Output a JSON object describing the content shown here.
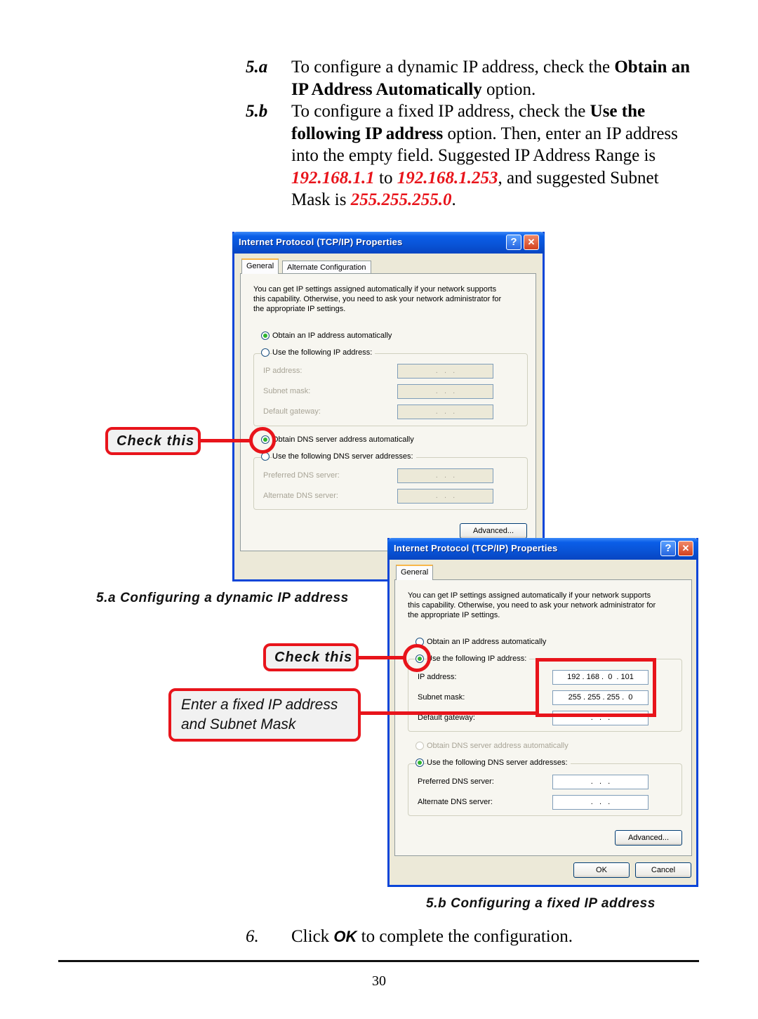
{
  "instructions": {
    "step_5a": {
      "number": "5.a",
      "text_before": "To configure a dynamic IP address, check the ",
      "bold": "Obtain an IP Address Automatically",
      "text_after": " option."
    },
    "step_5b": {
      "number": "5.b",
      "text_before": "To configure a fixed IP address, check the ",
      "bold": "Use the following IP address",
      "text_mid": " option.  Then, enter an IP address into the empty field.  Suggested IP Address Range is ",
      "range_start": "192.168.1.1",
      "to": " to ",
      "range_end": "192.168.1.253",
      "text_mask": ", and suggested Subnet Mask is ",
      "subnet_mask": "255.255.255.0",
      "period": "."
    },
    "step_6": {
      "number": "6.",
      "text_before": "Click ",
      "ok": "OK",
      "text_after": " to complete the configuration."
    }
  },
  "dialog_dynamic": {
    "title": "Internet Protocol (TCP/IP) Properties",
    "help_icon": "?",
    "close_icon": "✕",
    "tabs": [
      "General",
      "Alternate Configuration"
    ],
    "description": [
      "You can get IP settings assigned automatically if your network supports",
      "this capability. Otherwise, you need to ask your network administrator for",
      "the appropriate IP settings."
    ],
    "radio_obtain_ip": {
      "label": "Obtain an IP address automatically",
      "selected": true
    },
    "radio_use_ip": {
      "label": "Use the following IP address:",
      "selected": false
    },
    "fields": [
      {
        "label": "IP address:",
        "value": ".   .   ."
      },
      {
        "label": "Subnet mask:",
        "value": ".   .   ."
      },
      {
        "label": "Default gateway:",
        "value": ".   .   ."
      }
    ],
    "radio_obtain_dns": {
      "label": "Obtain DNS server address automatically",
      "selected": true
    },
    "radio_use_dns": {
      "label": "Use the following DNS server addresses:",
      "selected": false
    },
    "dns_fields": [
      {
        "label": "Preferred DNS server:",
        "value": ".   .   ."
      },
      {
        "label": "Alternate DNS server:",
        "value": ".   .   ."
      }
    ],
    "advanced_button": "Advanced..."
  },
  "dialog_fixed": {
    "title": "Internet Protocol (TCP/IP) Properties",
    "help_icon": "?",
    "close_icon": "✕",
    "tabs": [
      "General"
    ],
    "description": [
      "You can get IP settings assigned automatically if your network supports",
      "this capability. Otherwise, you need to ask your network administrator for",
      "the appropriate IP settings."
    ],
    "radio_obtain_ip": {
      "label": "Obtain an IP address automatically",
      "selected": false
    },
    "radio_use_ip": {
      "label": "Use the following IP address:",
      "selected": true
    },
    "fields": [
      {
        "label": "IP address:",
        "value": "192 . 168 .  0  . 101"
      },
      {
        "label": "Subnet mask:",
        "value": "255 . 255 . 255 .  0"
      },
      {
        "label": "Default gateway:",
        "value": ".   .   ."
      }
    ],
    "radio_obtain_dns": {
      "label": "Obtain DNS server address automatically",
      "selected": false
    },
    "radio_use_dns": {
      "label": "Use the following DNS server addresses:",
      "selected": true
    },
    "dns_fields": [
      {
        "label": "Preferred DNS server:",
        "value": ".   .   ."
      },
      {
        "label": "Alternate DNS server:",
        "value": ".   .   ."
      }
    ],
    "advanced_button": "Advanced...",
    "ok_button": "OK",
    "cancel_button": "Cancel"
  },
  "callouts": {
    "check_this_dynamic": "Check this",
    "check_this_fixed": "Check this",
    "enter_fixed": [
      "Enter a fixed IP address",
      "and Subnet Mask"
    ]
  },
  "captions": {
    "dynamic": "5.a Configuring a dynamic IP address",
    "fixed": "5.b Configuring a fixed IP address"
  },
  "footer": {
    "page_number": "30"
  },
  "colors": {
    "highlight_red": "#e8141b",
    "xp_title_blue": "#0a5ee8",
    "dialog_bg": "#ece9d8"
  }
}
